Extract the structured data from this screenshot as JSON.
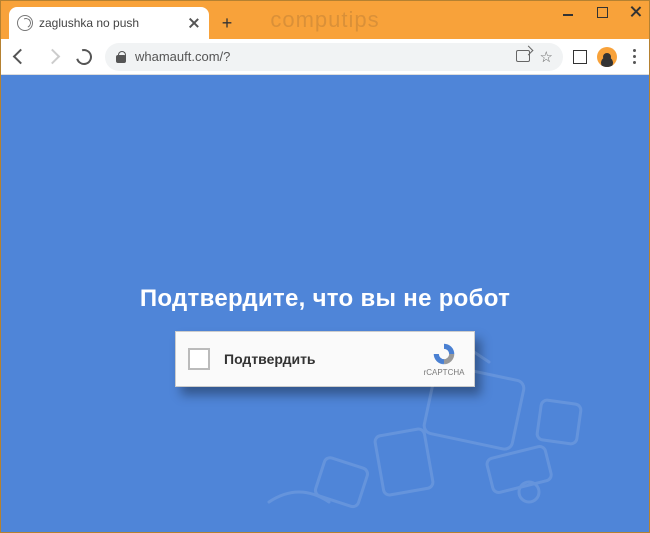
{
  "window": {
    "watermark": "computips"
  },
  "browser": {
    "tab": {
      "title": "zaglushka no push"
    },
    "address": {
      "url": "whamauft.com/?"
    }
  },
  "page": {
    "heading": "Подтвердите, что вы не робот",
    "captcha": {
      "label": "Подтвердить",
      "brand": "rCAPTCHA"
    }
  }
}
